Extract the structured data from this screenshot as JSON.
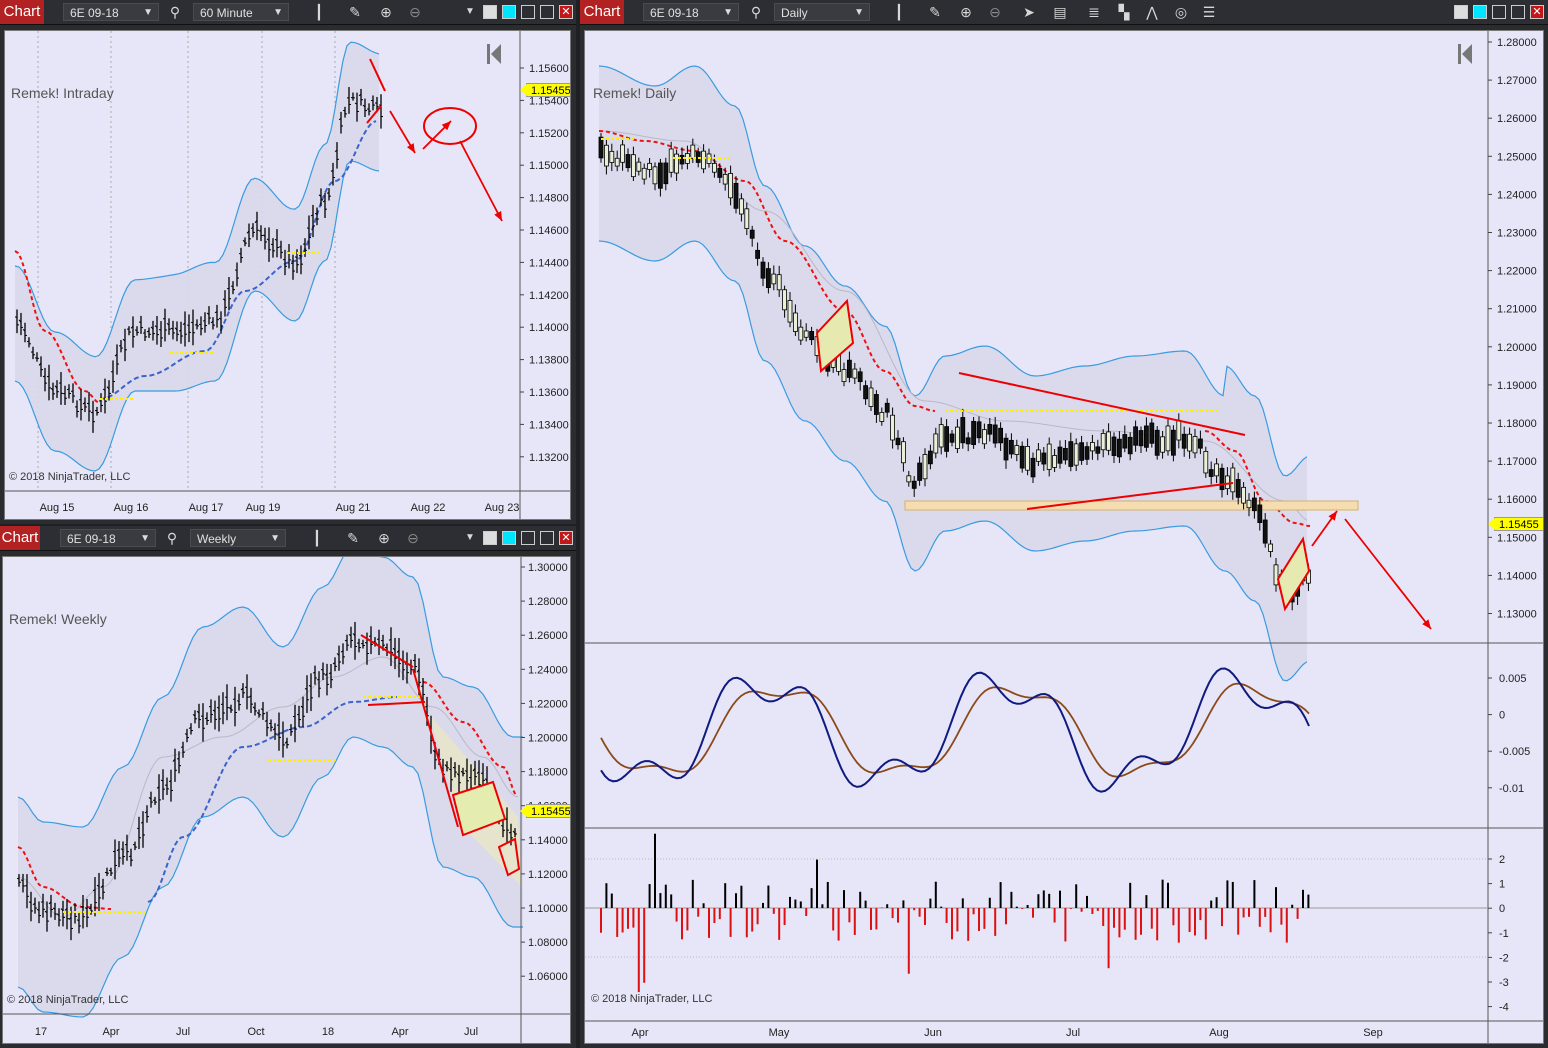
{
  "chart_tab_label": "Chart",
  "panels": {
    "intraday": {
      "instrument": "6E 09-18",
      "period": "60 Minute",
      "watermark": "Remek! Intraday",
      "copyright": "© 2018 NinjaTrader, LLC",
      "last_price": "1.15455",
      "y_ticks": [
        "1.15600",
        "1.15400",
        "1.15200",
        "1.15000",
        "1.14800",
        "1.14600",
        "1.14400",
        "1.14200",
        "1.14000",
        "1.13800",
        "1.13600",
        "1.13400",
        "1.13200"
      ],
      "x_ticks": [
        "Aug 15",
        "Aug 16",
        "Aug 17",
        "Aug 19",
        "Aug 21",
        "Aug 22",
        "Aug 23"
      ]
    },
    "weekly": {
      "instrument": "6E 09-18",
      "period": "Weekly",
      "watermark": "Remek! Weekly",
      "copyright": "© 2018 NinjaTrader, LLC",
      "last_price": "1.15455",
      "y_ticks": [
        "1.30000",
        "1.28000",
        "1.26000",
        "1.24000",
        "1.22000",
        "1.20000",
        "1.18000",
        "1.16000",
        "1.14000",
        "1.12000",
        "1.10000",
        "1.08000",
        "1.06000"
      ],
      "x_ticks": [
        "17",
        "Apr",
        "Jul",
        "Oct",
        "18",
        "Apr",
        "Jul"
      ]
    },
    "daily": {
      "instrument": "6E 09-18",
      "period": "Daily",
      "watermark": "Remek! Daily",
      "copyright": "© 2018 NinjaTrader, LLC",
      "last_price": "1.15455",
      "y_ticks": [
        "1.28000",
        "1.27000",
        "1.26000",
        "1.25000",
        "1.24000",
        "1.23000",
        "1.22000",
        "1.21000",
        "1.20000",
        "1.19000",
        "1.18000",
        "1.17000",
        "1.16000",
        "1.15000",
        "1.14000",
        "1.13000"
      ],
      "osc_ticks": [
        "0.005",
        "0",
        "-0.005",
        "-0.01"
      ],
      "hist_ticks": [
        "2",
        "1",
        "0",
        "-1",
        "-2",
        "-3",
        "-4"
      ],
      "x_ticks": [
        "Apr",
        "May",
        "Jun",
        "Jul",
        "Aug",
        "Sep"
      ]
    }
  },
  "colors": {
    "panel_bg": "#e6e6f8",
    "band_fill": "#d8d8ea",
    "band_line": "#3a9be0",
    "red_line": "#e11",
    "blue_dash": "#3b63c9",
    "support": "#f5ddb0",
    "osc_fast": "#101a80",
    "osc_slow": "#8b4a1a",
    "hist_pos": "#000000",
    "hist_neg": "#dd1111"
  }
}
